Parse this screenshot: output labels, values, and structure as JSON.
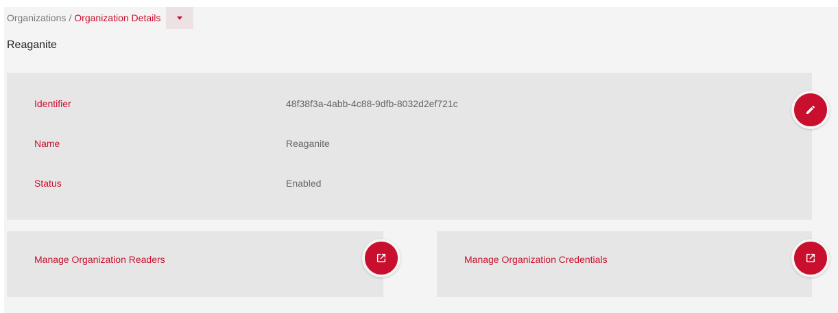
{
  "breadcrumb": {
    "parent": "Organizations",
    "separator": "/",
    "current": "Organization Details"
  },
  "page_title": "Reaganite",
  "details": {
    "identifier_label": "Identifier",
    "identifier_value": "48f38f3a-4abb-4c88-9dfb-8032d2ef721c",
    "name_label": "Name",
    "name_value": "Reaganite",
    "status_label": "Status",
    "status_value": "Enabled"
  },
  "actions": {
    "readers_label": "Manage Organization Readers",
    "credentials_label": "Manage Organization Credentials"
  },
  "icons": {
    "edit": "pencil-icon",
    "open": "open-in-new-icon",
    "dropdown": "caret-down-icon"
  },
  "colors": {
    "accent": "#c8102e",
    "card_background": "#e6e6e6",
    "page_background": "#f4f4f4"
  }
}
